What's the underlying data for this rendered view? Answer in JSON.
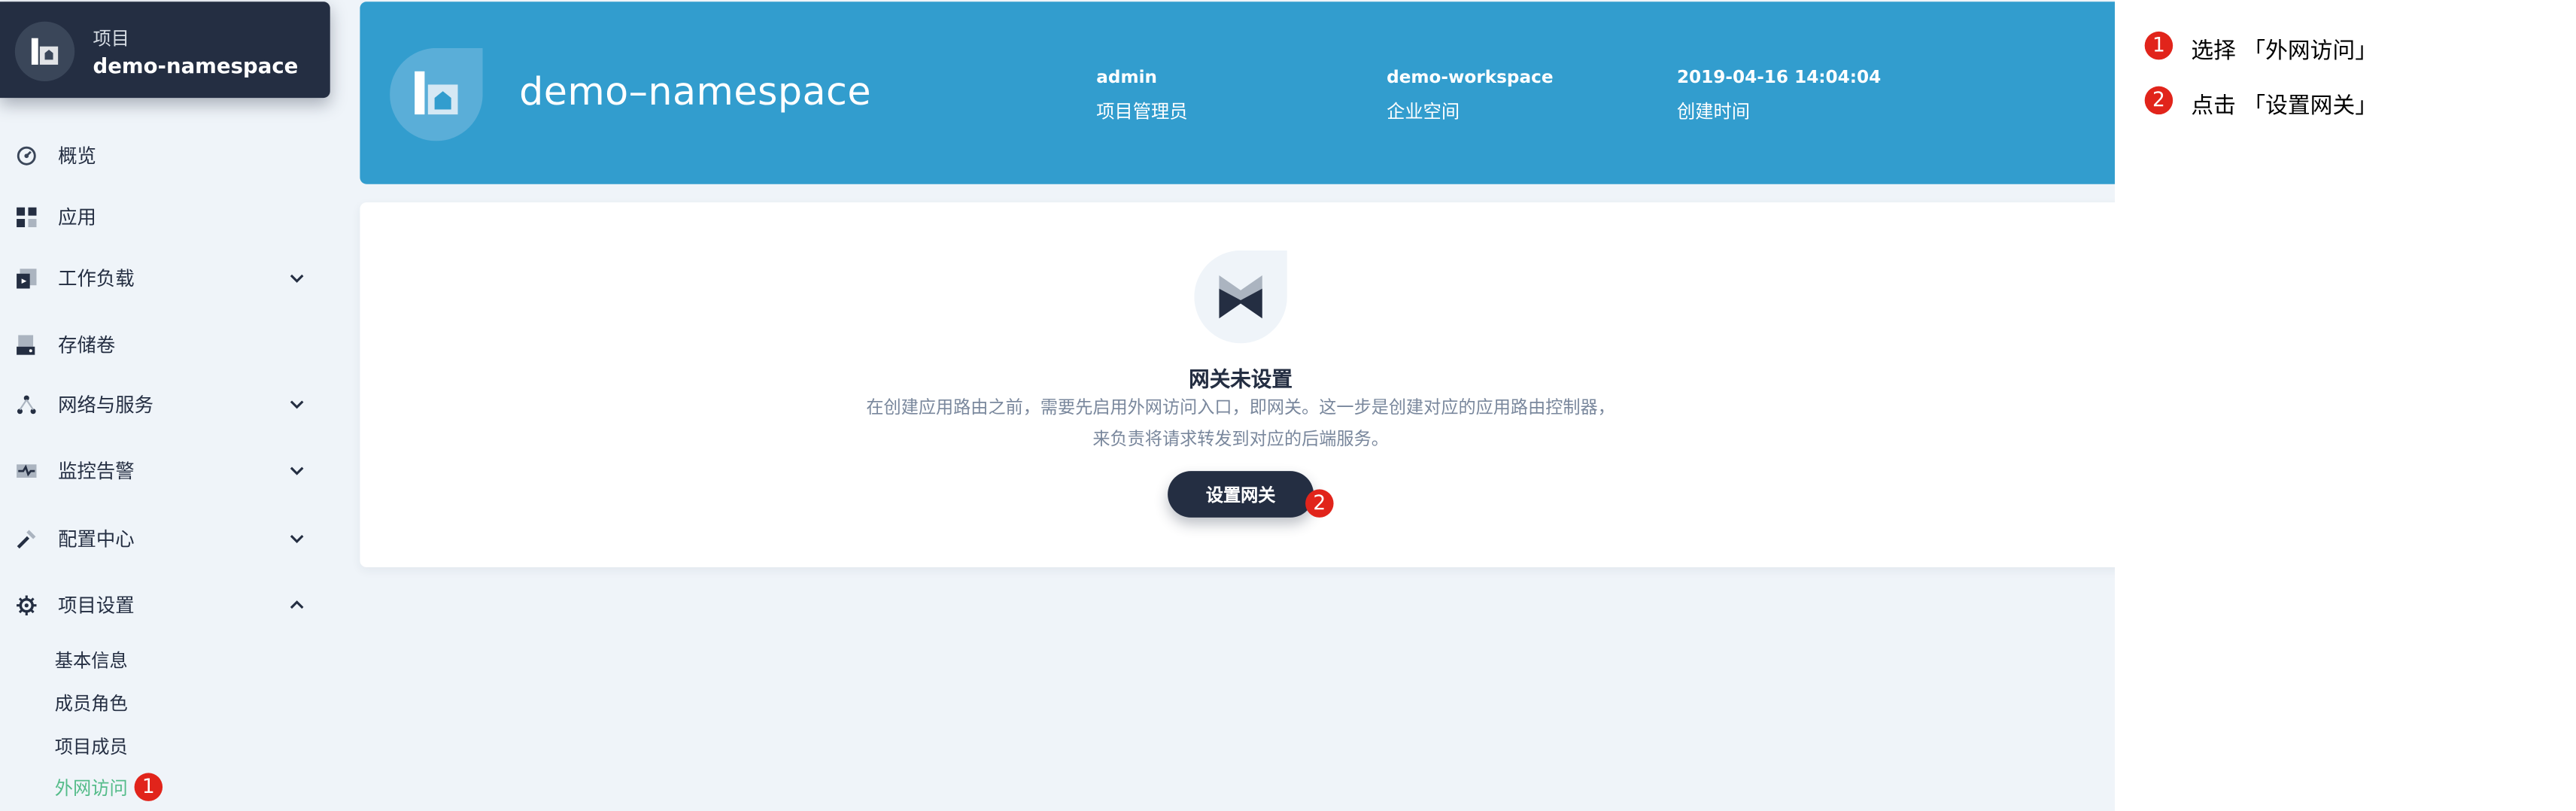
{
  "colors": {
    "sidebar_card": "#242e42",
    "banner": "#329dce",
    "page_bg": "#eff4f9",
    "active_link": "#55bc8a",
    "badge": "#e1241b",
    "primary_button": "#242e42"
  },
  "project": {
    "label": "项目",
    "name": "demo-namespace",
    "icon": "namespace-icon"
  },
  "nav": {
    "items": [
      {
        "label": "概览",
        "icon": "dashboard-icon"
      },
      {
        "label": "应用",
        "icon": "apps-icon"
      },
      {
        "label": "工作负载",
        "icon": "workload-icon"
      },
      {
        "label": "存储卷",
        "icon": "storage-icon"
      },
      {
        "label": "网络与服务",
        "icon": "network-icon"
      },
      {
        "label": "监控告警",
        "icon": "monitor-icon"
      },
      {
        "label": "配置中心",
        "icon": "config-icon"
      },
      {
        "label": "项目设置",
        "icon": "gear-icon"
      }
    ],
    "settings_sub": [
      {
        "label": "基本信息"
      },
      {
        "label": "成员角色"
      },
      {
        "label": "项目成员"
      },
      {
        "label": "外网访问",
        "active": true
      }
    ],
    "badge": "1"
  },
  "banner": {
    "title": "demo–namespace",
    "meta": [
      {
        "value": "admin",
        "key": "项目管理员"
      },
      {
        "value": "demo-workspace",
        "key": "企业空间"
      },
      {
        "value": "2019-04-16 14:04:04",
        "key": "创建时间"
      }
    ]
  },
  "gateway": {
    "title": "网关未设置",
    "desc_line1": "在创建应用路由之前，需要先启用外网访问入口，即网关。这一步是创建对应的应用路由控制器，",
    "desc_line2": "来负责将请求转发到对应的后端服务。",
    "button_label": "设置网关",
    "badge": "2"
  },
  "instructions": [
    {
      "num": "1",
      "text": "选择 「外网访问」"
    },
    {
      "num": "2",
      "text": "点击 「设置网关」"
    }
  ]
}
